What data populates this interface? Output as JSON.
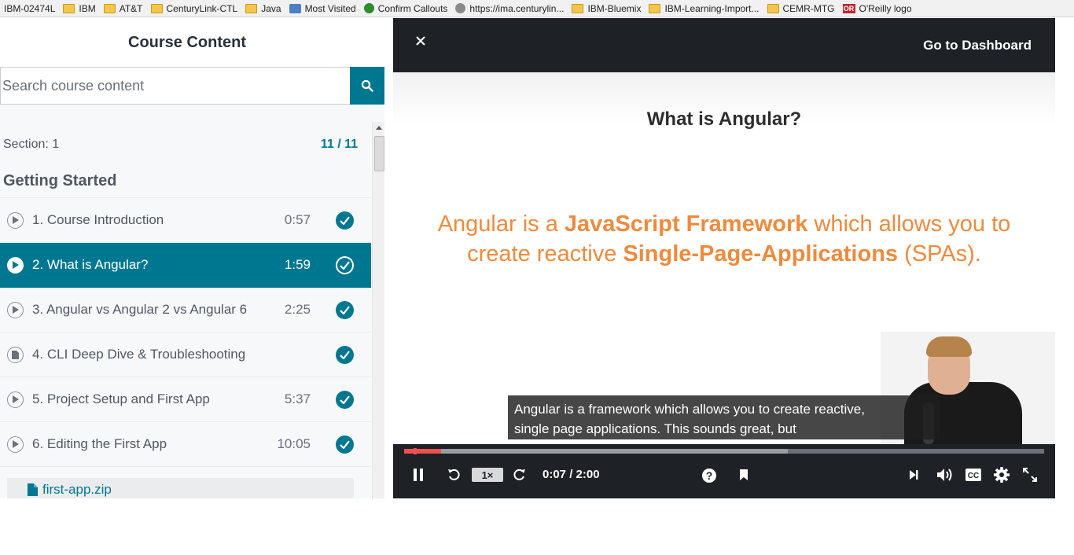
{
  "bookmarks": [
    {
      "label": "IBM-02474L",
      "icon": "none-icon"
    },
    {
      "label": "IBM",
      "icon": "folder-icon"
    },
    {
      "label": "AT&T",
      "icon": "folder-icon"
    },
    {
      "label": "CenturyLink-CTL",
      "icon": "folder-icon"
    },
    {
      "label": "Java",
      "icon": "folder-icon"
    },
    {
      "label": "Most Visited",
      "icon": "most-visited-icon"
    },
    {
      "label": "Confirm Callouts",
      "icon": "confirm-callouts-icon"
    },
    {
      "label": "https://ima.centurylin...",
      "icon": "globe-icon"
    },
    {
      "label": "IBM-Bluemix",
      "icon": "folder-icon"
    },
    {
      "label": "IBM-Learning-Import...",
      "icon": "folder-icon"
    },
    {
      "label": "CEMR-MTG",
      "icon": "folder-icon"
    },
    {
      "label": "O'Reilly logo",
      "icon": "oreilly-icon"
    }
  ],
  "sidebar": {
    "title": "Course Content",
    "search_placeholder": "Search course content",
    "section": {
      "label": "Section: 1",
      "count": "11 / 11",
      "title": "Getting Started"
    },
    "lectures": [
      {
        "title": "1. Course Introduction",
        "duration": "0:57",
        "type": "video",
        "active": false
      },
      {
        "title": "2. What is Angular?",
        "duration": "1:59",
        "type": "video",
        "active": true
      },
      {
        "title": "3. Angular vs Angular 2 vs Angular 6",
        "duration": "2:25",
        "type": "video",
        "active": false
      },
      {
        "title": "4. CLI Deep Dive & Troubleshooting",
        "duration": "",
        "type": "article",
        "active": false
      },
      {
        "title": "5. Project Setup and First App",
        "duration": "5:37",
        "type": "video",
        "active": false
      },
      {
        "title": "6. Editing the First App",
        "duration": "10:05",
        "type": "video",
        "active": false
      }
    ],
    "resource": {
      "label": "first-app.zip"
    }
  },
  "player": {
    "dashboard_label": "Go to Dashboard",
    "slide": {
      "title": "What is Angular?",
      "line1_pre": "Angular is a ",
      "line1_bold": "JavaScript Framework",
      "line1_post": " which allows you to",
      "line2_pre": "create reactive ",
      "line2_bold": "Single-Page-Applications",
      "line2_post": " (SPAs)."
    },
    "caption": {
      "line1": "Angular is a framework which allows you to create reactive,",
      "line2": "single page applications. This sounds great, but"
    },
    "speed": "1×",
    "time": "0:07 / 2:00",
    "progress_fraction": 0.058,
    "buffered_fraction": 0.6
  },
  "colors": {
    "accent": "#007791",
    "progress": "#ec5252",
    "player_bg": "#1e2126",
    "slide_orange": "#ef8a3d"
  }
}
